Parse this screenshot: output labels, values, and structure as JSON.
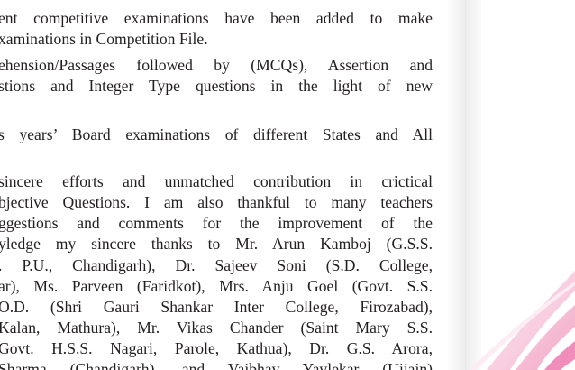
{
  "document": {
    "lines": [
      "ent competitive examinations have been added to make",
      "xaminations in Competition File.",
      "ehension/Passages followed by (MCQs), Assertion and",
      "stions and Integer Type questions in the light of new",
      "",
      "s years’ Board examinations of different States and All",
      "",
      "sincere efforts and unmatched contribution in crictical",
      "bjective Questions. I am also thankful to many teachers",
      "ggestions and comments for the improvement of the",
      "yledge my sincere thanks to Mr. Arun Kamboj (G.S.S.",
      ". P.U., Chandigarh), Dr. Sajeev Soni (S.D. College,",
      "ar), Ms. Parveen (Faridkot), Mrs. Anju Goel (Govt. S.S.",
      "O.D. (Shri Gauri Shankar Inter College, Firozabad),",
      "Kalan, Mathura), Mr. Vikas Chander (Saint Mary S.S.",
      "Govt. H.S.S. Nagari, Parole, Kathua), Dr. G.S. Arora,",
      "Sharma (Chandigarh), and Vaibhav Yavlekar (Ujjain)"
    ]
  }
}
